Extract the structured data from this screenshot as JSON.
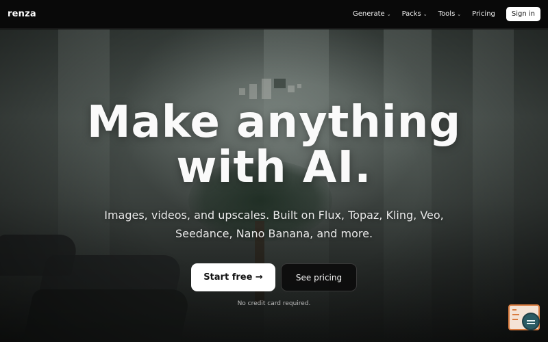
{
  "brand": {
    "logo": "renza"
  },
  "nav": {
    "items": [
      {
        "label": "Generate",
        "has_dropdown": true
      },
      {
        "label": "Packs",
        "has_dropdown": true
      },
      {
        "label": "Tools",
        "has_dropdown": true
      },
      {
        "label": "Pricing",
        "has_dropdown": false
      }
    ],
    "signin_label": "Sign in",
    "dropdown_glyph": "⌄"
  },
  "hero": {
    "headline_line1": "Make anything",
    "headline_line2": "with AI.",
    "subtitle": "Images, videos, and upscales. Built on Flux, Topaz, Kling, Veo, Seedance, Nano Banana, and more.",
    "primary_cta": "Start free →",
    "secondary_cta": "See pricing",
    "note": "No credit card required."
  },
  "widget": {
    "icon": "search-widget-icon",
    "accent_color": "#d97b3e"
  },
  "colors": {
    "background": "#0b0b0b",
    "nav_bg": "#090909",
    "text": "#fafafa",
    "button_bg": "#ffffff"
  }
}
